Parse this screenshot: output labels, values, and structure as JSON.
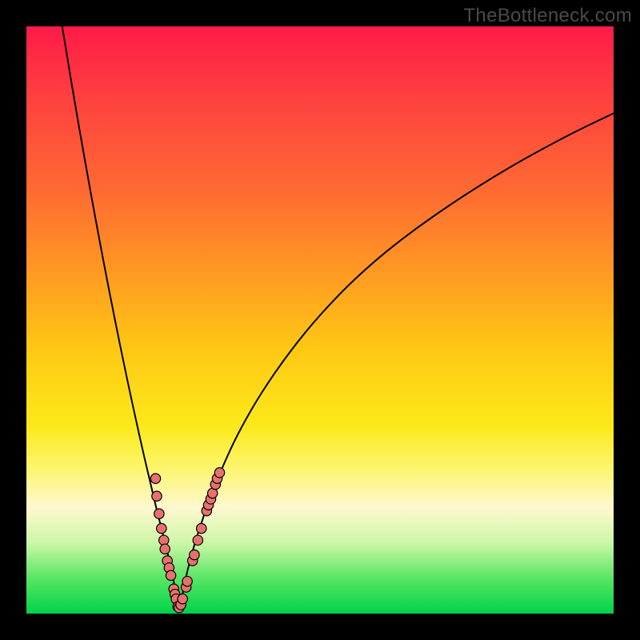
{
  "watermark": "TheBottleneck.com",
  "colors": {
    "background": "#000000",
    "curve": "#000000",
    "dot_fill": "#e8716f",
    "dot_stroke": "#000000"
  },
  "chart_data": {
    "type": "line",
    "title": "",
    "xlabel": "",
    "ylabel": "",
    "xlim": [
      0,
      100
    ],
    "ylim": [
      0,
      100
    ],
    "grid": false,
    "series": [
      {
        "name": "bottleneck-curve",
        "x_optimum": 25.9,
        "description": "V-shaped bottleneck curve; y≈0 at x≈25.9, rising steeply to the left to y=100 at x≈6 and rising with diminishing slope to the right reaching y≈85 at x=100.",
        "x": [
          6.1,
          8,
          10,
          12,
          14,
          16,
          18,
          20,
          22,
          23,
          24,
          25,
          25.9,
          27,
          28,
          29,
          30,
          31,
          33,
          36,
          40,
          45,
          50,
          56,
          63,
          72,
          82,
          92,
          100
        ],
        "y": [
          100,
          88.5,
          77,
          66,
          55.5,
          45.5,
          36,
          27,
          18.5,
          14.5,
          10.5,
          6,
          0.5,
          5.5,
          9.5,
          13,
          16,
          19,
          24,
          30.5,
          37.5,
          44.7,
          50.8,
          57,
          63,
          69.5,
          75.8,
          81.3,
          85.2
        ]
      }
    ],
    "datapoints": [
      {
        "x": 22.0,
        "y": 23.0
      },
      {
        "x": 22.2,
        "y": 20.0
      },
      {
        "x": 22.6,
        "y": 17.0
      },
      {
        "x": 23.0,
        "y": 14.5
      },
      {
        "x": 23.4,
        "y": 12.5
      },
      {
        "x": 23.6,
        "y": 11.0
      },
      {
        "x": 24.0,
        "y": 9.0
      },
      {
        "x": 24.3,
        "y": 7.8
      },
      {
        "x": 24.6,
        "y": 6.5
      },
      {
        "x": 25.1,
        "y": 4.2
      },
      {
        "x": 25.3,
        "y": 3.3
      },
      {
        "x": 25.5,
        "y": 2.5
      },
      {
        "x": 25.8,
        "y": 1.2
      },
      {
        "x": 26.0,
        "y": 1.0
      },
      {
        "x": 26.3,
        "y": 1.5
      },
      {
        "x": 26.6,
        "y": 2.5
      },
      {
        "x": 27.2,
        "y": 4.5
      },
      {
        "x": 27.4,
        "y": 5.5
      },
      {
        "x": 28.3,
        "y": 9.0
      },
      {
        "x": 28.6,
        "y": 10.0
      },
      {
        "x": 29.2,
        "y": 12.5
      },
      {
        "x": 29.8,
        "y": 14.5
      },
      {
        "x": 30.7,
        "y": 17.5
      },
      {
        "x": 31.0,
        "y": 18.5
      },
      {
        "x": 31.4,
        "y": 19.5
      },
      {
        "x": 31.7,
        "y": 20.5
      },
      {
        "x": 32.2,
        "y": 22.0
      },
      {
        "x": 32.5,
        "y": 23.0
      },
      {
        "x": 32.9,
        "y": 24.0
      }
    ]
  }
}
